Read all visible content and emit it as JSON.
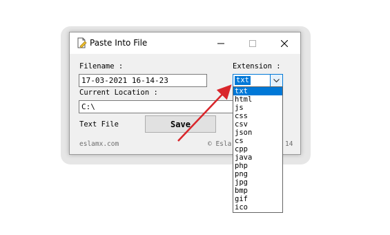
{
  "window": {
    "title": "Paste Into File"
  },
  "form": {
    "filename_label": "Filename :",
    "filename_value": "17-03-2021 16-14-23",
    "extension_label": "Extension :",
    "location_label": "Current Location :",
    "location_value": "C:\\",
    "file_type_label": "Text File",
    "save_label": "Save"
  },
  "footer": {
    "left": "eslamx.com",
    "right_start": "© Esla",
    "right_end": "14"
  },
  "extension": {
    "selected": "txt",
    "options": [
      "txt",
      "html",
      "js",
      "css",
      "csv",
      "json",
      "cs",
      "cpp",
      "java",
      "php",
      "png",
      "jpg",
      "bmp",
      "gif",
      "ico"
    ]
  },
  "colors": {
    "accent": "#0078d7",
    "annotation_arrow": "#d9262b"
  },
  "icons": {
    "app": "paste-file-icon",
    "dropdown": "chevron-down-icon",
    "minimize": "minimize-icon",
    "maximize": "maximize-icon",
    "close": "close-icon"
  }
}
